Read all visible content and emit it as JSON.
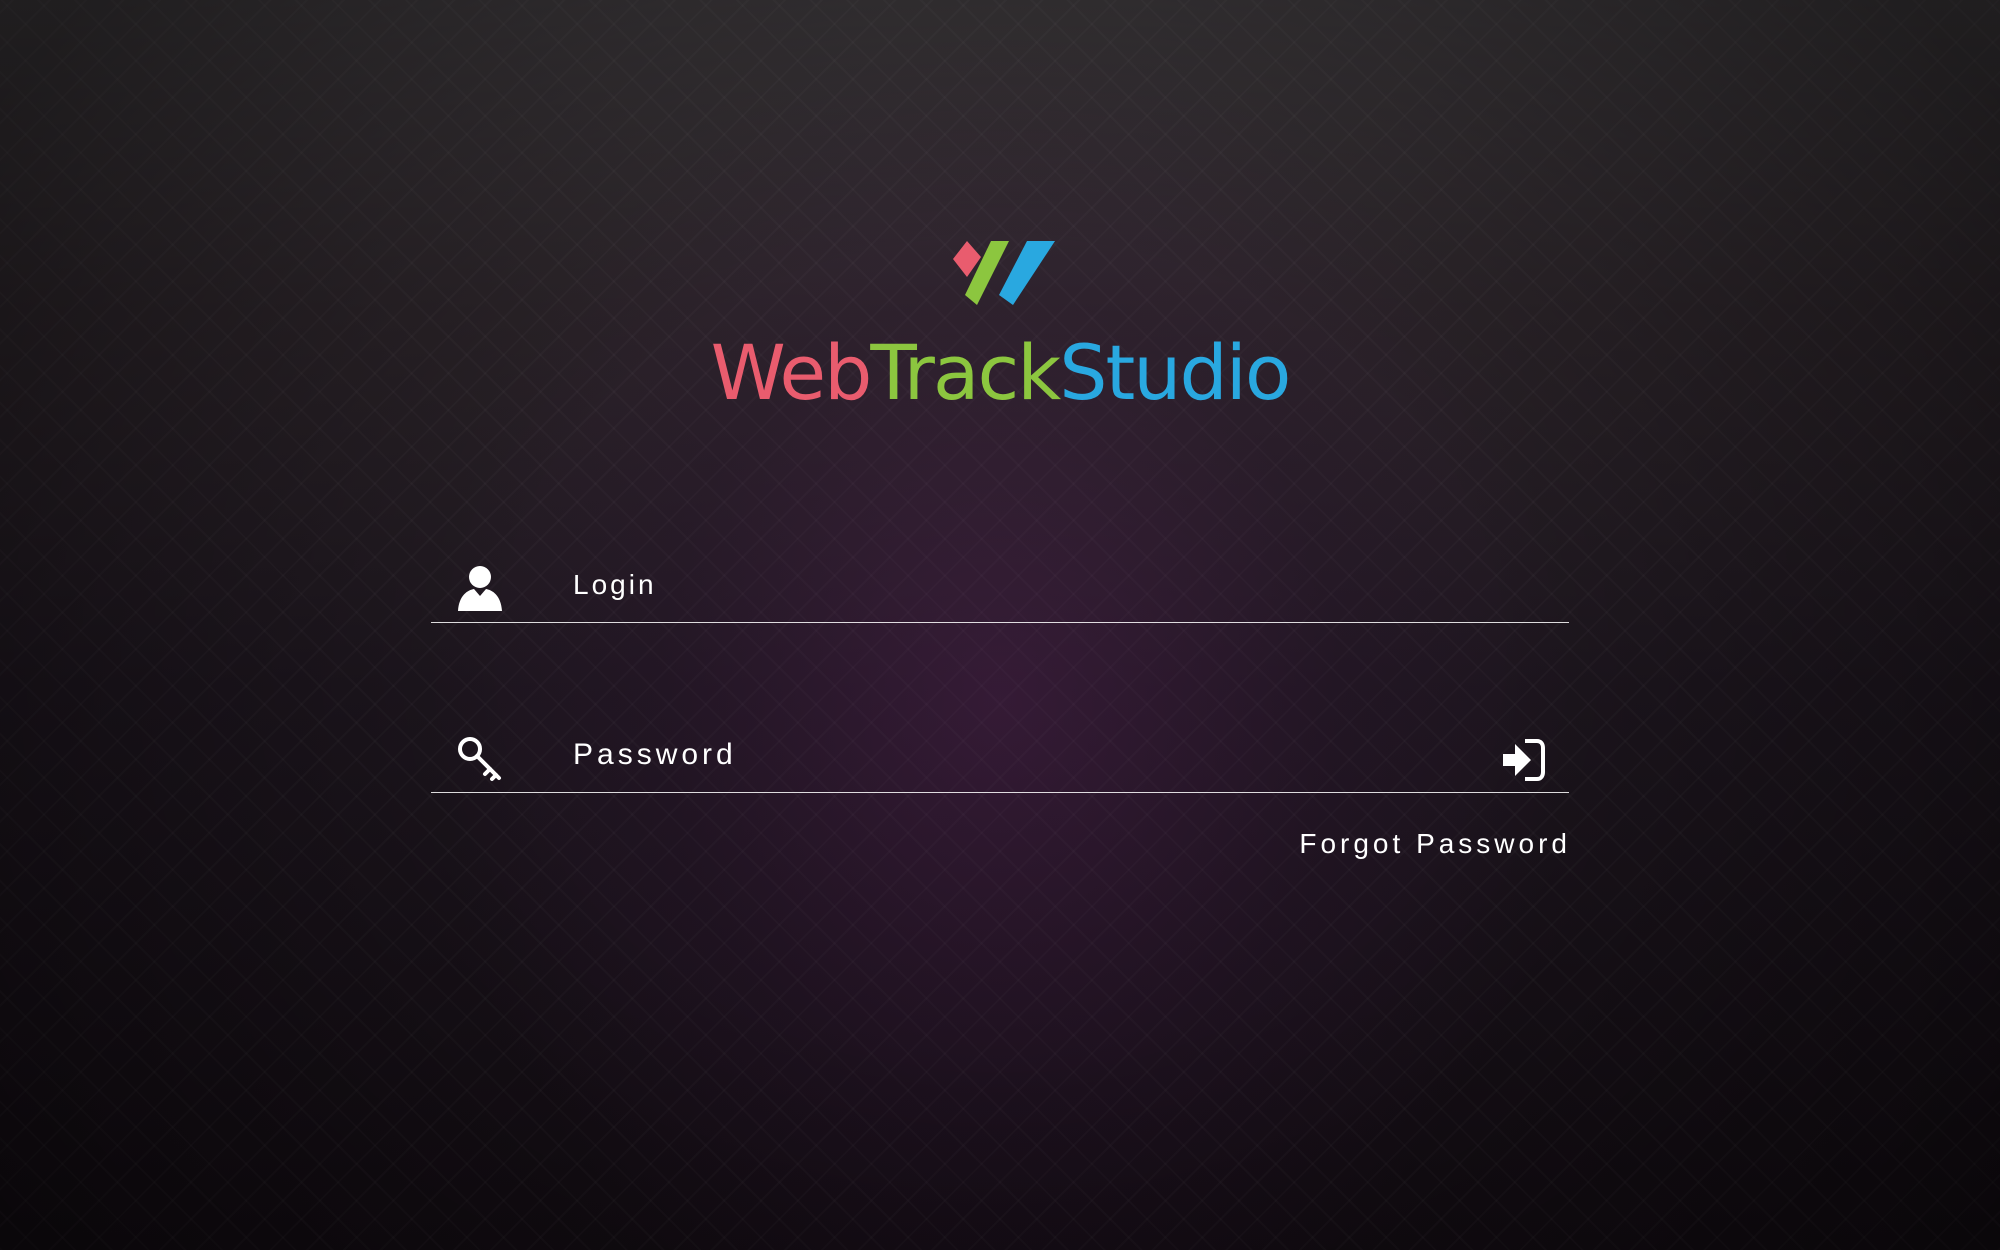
{
  "logo": {
    "part_web": "Web",
    "part_track": "Track",
    "part_studio": "Studio",
    "colors": {
      "web": "#e95c6e",
      "track": "#8cc63f",
      "studio": "#29a8e0"
    }
  },
  "login_field": {
    "icon": "user-icon",
    "placeholder": "Login",
    "value": ""
  },
  "password_field": {
    "icon": "key-icon",
    "placeholder": "Password",
    "value": ""
  },
  "submit": {
    "icon": "sign-in-icon"
  },
  "forgot_password_label": "Forgot Password"
}
